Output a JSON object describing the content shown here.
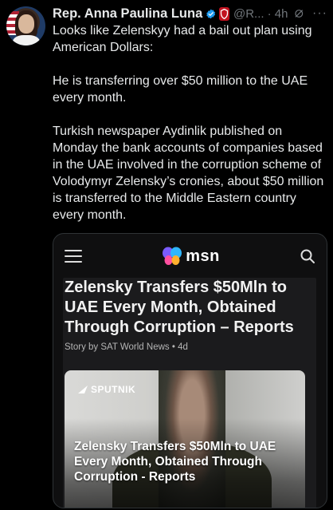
{
  "post": {
    "author_name": "Rep. Anna Paulina Luna",
    "author_handle": "@R...",
    "time_ago": "4h",
    "more_glyph": "···",
    "badge_icons": [
      "verified-icon",
      "congress-badge-icon"
    ],
    "paragraphs": [
      "Looks like Zelenskyy had a bail out plan using American Dollars:",
      "He is transferring over $50 million to the UAE every month.",
      "Turkish newspaper Aydinlik published on Monday the bank accounts of companies based in the UAE involved in the corruption scheme of Volodymyr Zelensky’s cronies, about $50 million is transferred to the Middle Eastern country every month."
    ]
  },
  "card": {
    "site_name": "msn",
    "headline": "Zelensky Transfers $50Mln to UAE Every Month, Obtained Through Corruption – Reports",
    "byline": "Story by SAT World News • 4d",
    "image": {
      "watermark": "SPUTNIK",
      "caption": "Zelensky Transfers $50Mln to UAE Every Month, Obtained Through Corruption - Reports"
    }
  },
  "colors": {
    "background": "#000000",
    "text": "#e7e9ea",
    "muted": "#71767b",
    "verified": "#1d9bf0",
    "badge_red": "#c1121f"
  }
}
